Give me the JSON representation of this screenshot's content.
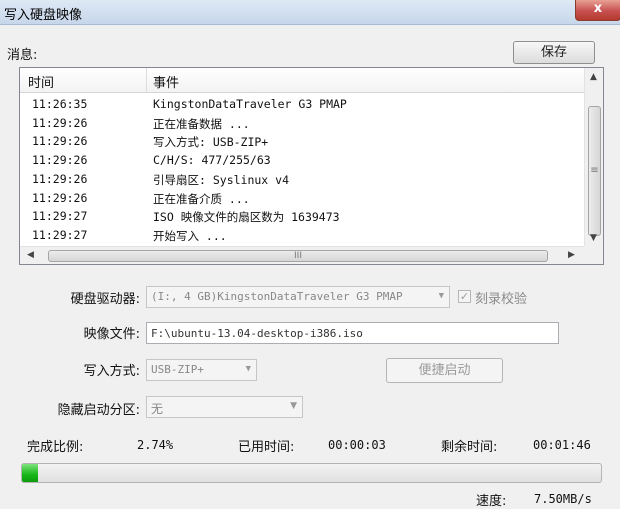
{
  "window": {
    "title": "写入硬盘映像",
    "close_glyph": "x"
  },
  "messages": {
    "label": "消息:",
    "save_label": "保存",
    "columns": {
      "time": "时间",
      "event": "事件"
    },
    "rows": [
      {
        "time": "11:26:35",
        "event": "KingstonDataTraveler G3 PMAP"
      },
      {
        "time": "11:29:26",
        "event": "正在准备数据 ..."
      },
      {
        "time": "11:29:26",
        "event": "写入方式: USB-ZIP+"
      },
      {
        "time": "11:29:26",
        "event": "C/H/S: 477/255/63"
      },
      {
        "time": "11:29:26",
        "event": "引导扇区: Syslinux v4"
      },
      {
        "time": "11:29:26",
        "event": "正在准备介质 ..."
      },
      {
        "time": "11:29:27",
        "event": "ISO 映像文件的扇区数为 1639473"
      },
      {
        "time": "11:29:27",
        "event": "开始写入 ..."
      }
    ],
    "scroll_grip": "≡",
    "hscroll_grip": "III"
  },
  "form": {
    "drive_label": "硬盘驱动器:",
    "drive_value": "(I:, 4 GB)KingstonDataTraveler G3 PMAP",
    "verify_label": "刻录校验",
    "verify_checked": true,
    "image_label": "映像文件:",
    "image_value": "F:\\ubuntu-13.04-desktop-i386.iso",
    "write_mode_label": "写入方式:",
    "write_mode_value": "USB-ZIP+",
    "quick_boot_label": "便捷启动",
    "hidden_partition_label": "隐藏启动分区:",
    "hidden_partition_value": "无"
  },
  "status": {
    "percent_label": "完成比例:",
    "percent_value": "2.74%",
    "elapsed_label": "已用时间:",
    "elapsed_value": "00:00:03",
    "remaining_label": "剩余时间:",
    "remaining_value": "00:01:46",
    "progress_fraction": 0.0274,
    "speed_label": "速度:",
    "speed_value": "7.50MB/s"
  },
  "colors": {
    "progress": "#16b616",
    "close_button": "#c75050"
  }
}
